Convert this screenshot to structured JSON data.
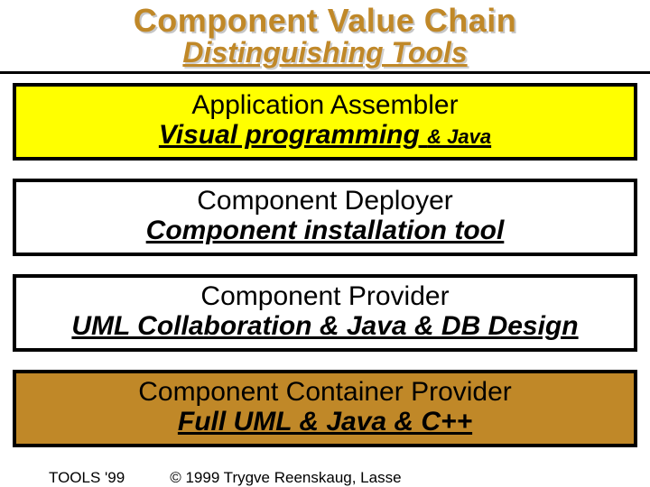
{
  "header": {
    "title": "Component Value Chain",
    "subtitle": "Distinguishing Tools"
  },
  "blocks": [
    {
      "role": "Application Assembler",
      "tool": "Visual programming",
      "tool_suffix": "& Java",
      "bg": "#ffff00"
    },
    {
      "role": "Component Deployer",
      "tool": "Component installation tool",
      "tool_suffix": "",
      "bg": "#ffffff"
    },
    {
      "role": "Component Provider",
      "tool": "UML Collaboration & Java & DB Design",
      "tool_suffix": "",
      "bg": "#ffffff"
    },
    {
      "role": "Component Container Provider",
      "tool": "Full UML & Java & C++",
      "tool_suffix": "",
      "bg": "#c08828"
    }
  ],
  "footer": {
    "ref": "TOOLS '99",
    "copy": "© 1999 Trygve Reenskaug, Lasse"
  }
}
